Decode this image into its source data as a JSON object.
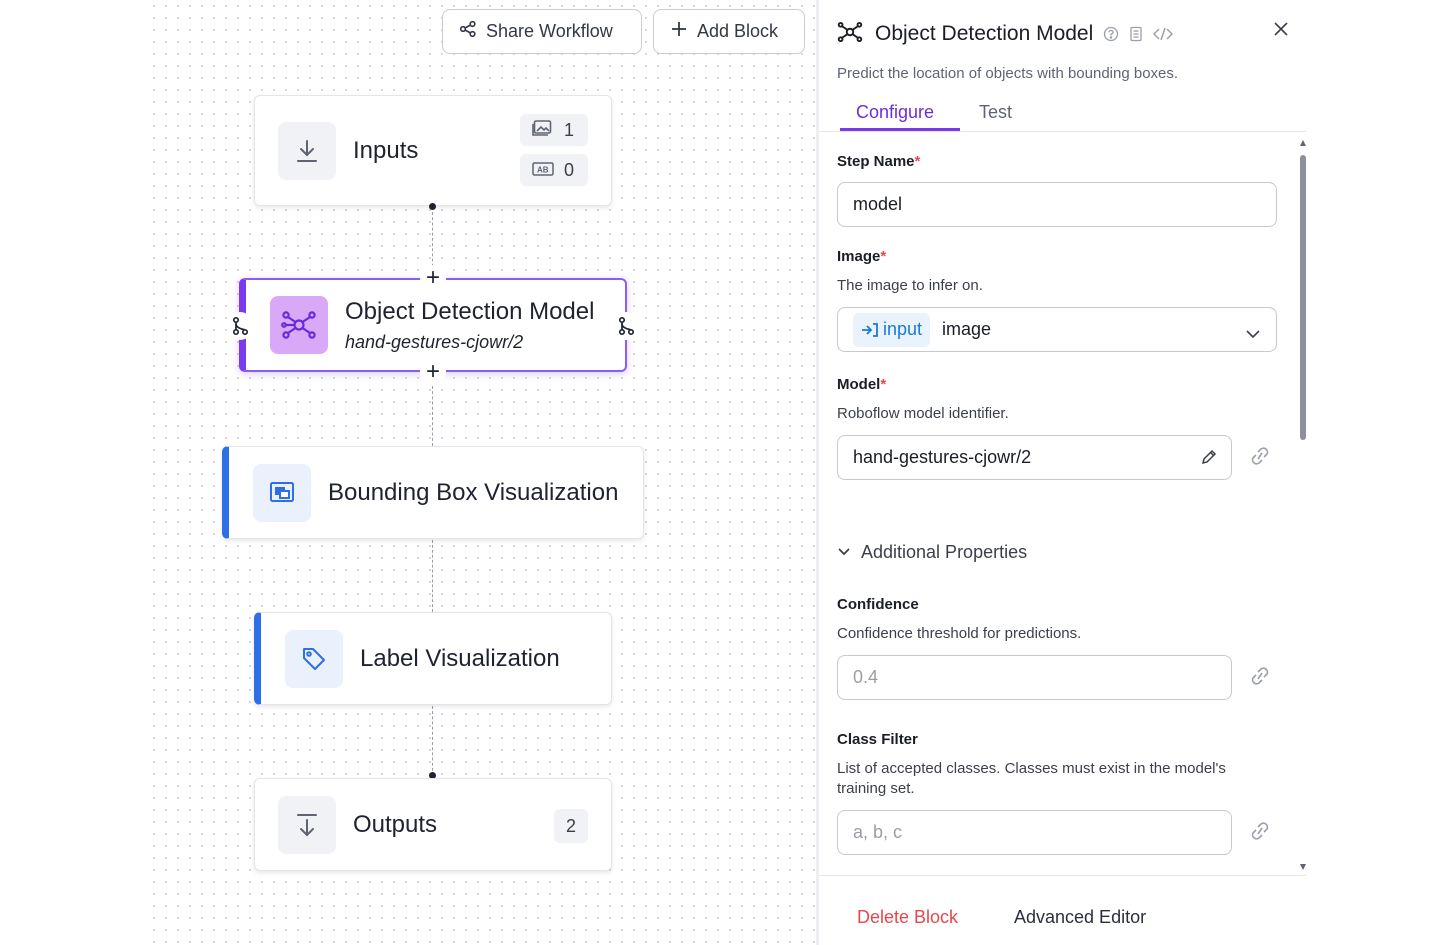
{
  "toolbar": {
    "share_label": "Share Workflow",
    "add_block_label": "Add Block"
  },
  "workflow": {
    "inputs": {
      "title": "Inputs",
      "image_count": "1",
      "param_count": "0"
    },
    "model_node": {
      "title": "Object Detection Model",
      "subtitle": "hand-gestures-cjowr/2"
    },
    "bbox_node": {
      "title": "Bounding Box Visualization"
    },
    "label_node": {
      "title": "Label Visualization"
    },
    "outputs": {
      "title": "Outputs",
      "count": "2"
    }
  },
  "panel": {
    "title": "Object Detection Model",
    "description": "Predict the location of objects with bounding boxes.",
    "tabs": [
      "Configure",
      "Test"
    ],
    "active_tab": "Configure",
    "fields": {
      "step_name": {
        "label": "Step Name",
        "required": "*",
        "value": "model"
      },
      "image": {
        "label": "Image",
        "required": "*",
        "help": "The image to infer on.",
        "chip": "input",
        "value": "image"
      },
      "model": {
        "label": "Model",
        "required": "*",
        "help": "Roboflow model identifier.",
        "value": "hand-gestures-cjowr/2"
      },
      "additional": {
        "label": "Additional Properties"
      },
      "confidence": {
        "label": "Confidence",
        "help": "Confidence threshold for predictions.",
        "placeholder": "0.4"
      },
      "class_filter": {
        "label": "Class Filter",
        "help_line1": "List of accepted classes. Classes must exist in the model's",
        "help_line2": "training set.",
        "placeholder": "a, b, c"
      }
    },
    "footer": {
      "delete_label": "Delete Block",
      "advanced_label": "Advanced Editor"
    }
  },
  "colors": {
    "accent_purple": "#7c3aed",
    "visualization_blue": "#2f6fe6",
    "delete_red": "#e5484d",
    "link_blue": "#1a7bd0"
  },
  "icons": {
    "share": "share-nodes-icon",
    "add": "plus-icon",
    "inputs": "download-icon",
    "model": "model-graph-icon",
    "bbox": "bounding-box-icon",
    "label": "tag-icon",
    "outputs": "upload-down-icon",
    "close": "close-icon",
    "help": "question-icon",
    "docs": "document-icon",
    "code": "code-icon",
    "link": "link-icon",
    "edit": "pencil-icon",
    "chevron": "chevron-down-icon"
  }
}
